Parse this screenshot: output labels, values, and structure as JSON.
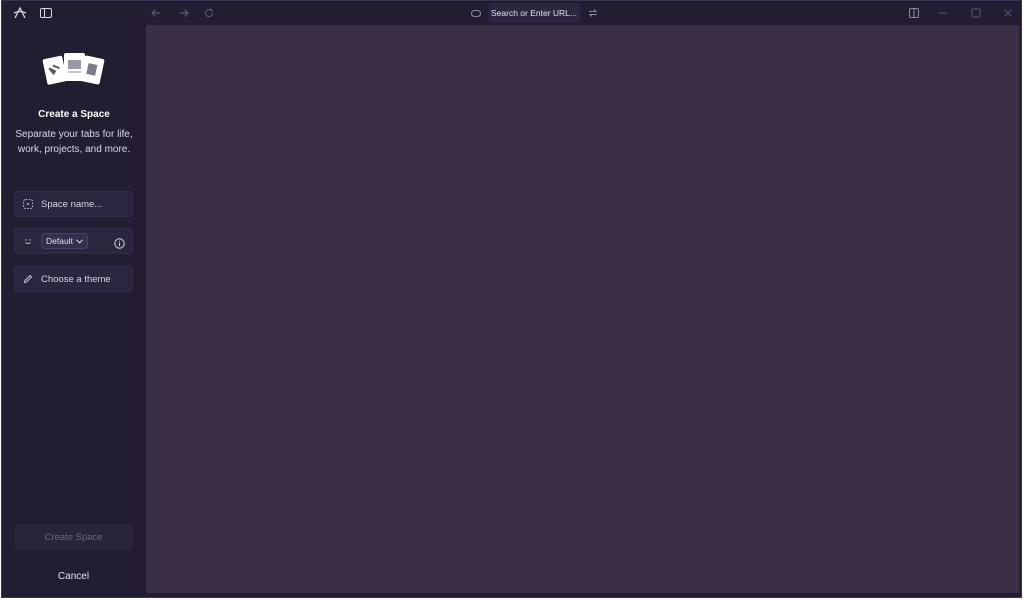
{
  "topbar": {
    "url_placeholder": "Search or Enter URL...",
    "icons": [
      "arc-logo-icon",
      "sidebar-toggle-icon",
      "back-icon",
      "forward-icon",
      "reload-icon",
      "site-icon",
      "sync-icon",
      "split-view-icon",
      "minimize-icon",
      "maximize-icon",
      "close-icon"
    ]
  },
  "sidebar": {
    "title": "Create a Space",
    "subtitle": "Separate your tabs for life, work, projects, and more.",
    "space_name_placeholder": "Space name...",
    "profile_label": "Default",
    "theme_label": "Choose a theme",
    "create_label": "Create Space",
    "cancel_label": "Cancel"
  },
  "colors": {
    "sidebar_bg": "#221d31",
    "content_bg": "#3a2f44",
    "field_bg": "#2b2540"
  }
}
